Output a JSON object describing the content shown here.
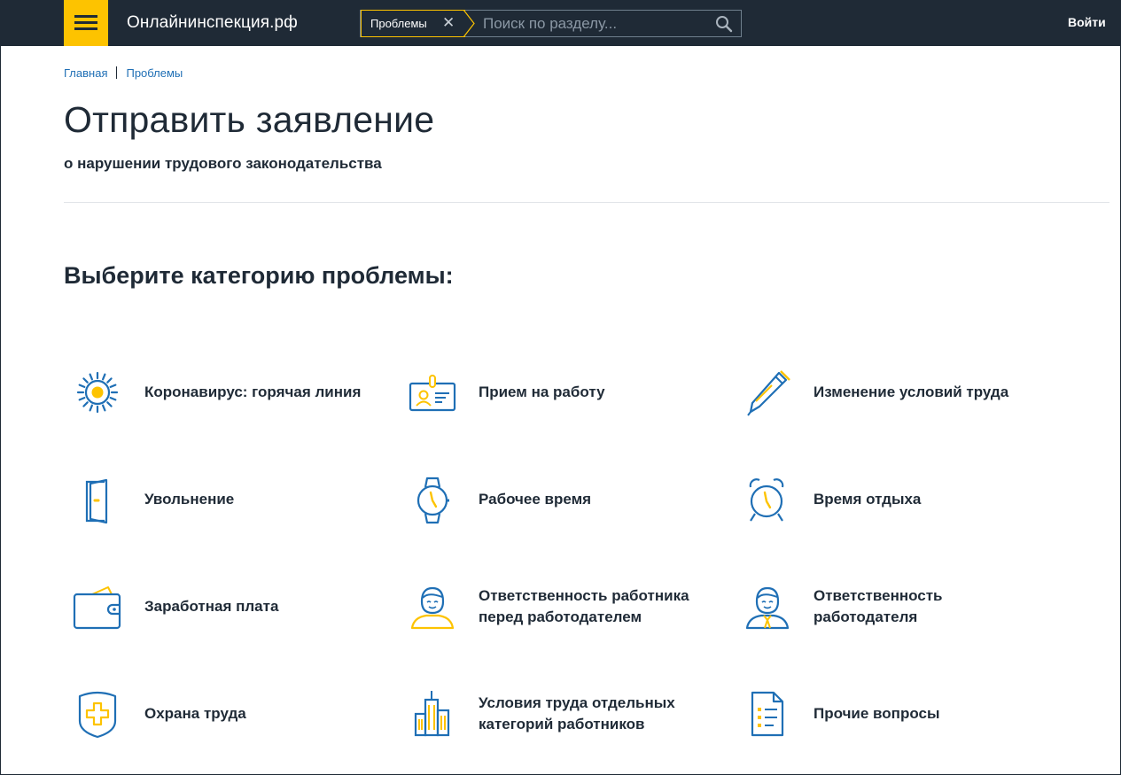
{
  "header": {
    "site_name": "Онлайнинспекция.рф",
    "search_chip": "Проблемы",
    "search_placeholder": "Поиск по разделу...",
    "login_label": "Войти"
  },
  "breadcrumb": [
    "Главная",
    "Проблемы"
  ],
  "page": {
    "title": "Отправить заявление",
    "subtitle": "о нарушении трудового законодательства",
    "section_title": "Выберите категорию проблемы:"
  },
  "categories": [
    {
      "label": "Коронавирус: горячая линия",
      "icon": "virus-icon"
    },
    {
      "label": "Прием на работу",
      "icon": "id-badge-icon"
    },
    {
      "label": "Изменение условий труда",
      "icon": "pen-icon"
    },
    {
      "label": "Увольнение",
      "icon": "door-icon"
    },
    {
      "label": "Рабочее время",
      "icon": "wristwatch-icon"
    },
    {
      "label": "Время отдыха",
      "icon": "alarm-clock-icon"
    },
    {
      "label": "Заработная плата",
      "icon": "wallet-icon"
    },
    {
      "label": "Ответственность работника\nперед работодателем",
      "icon": "employee-icon"
    },
    {
      "label": "Ответственность\nработодателя",
      "icon": "employer-icon"
    },
    {
      "label": "Охрана труда",
      "icon": "shield-cross-icon"
    },
    {
      "label": "Условия труда отдельных\nкатегорий работников",
      "icon": "buildings-icon"
    },
    {
      "label": "Прочие вопросы",
      "icon": "document-list-icon"
    }
  ],
  "colors": {
    "accent": "#fdc300",
    "icon_blue": "#1f6fb5",
    "header_bg": "#1f2a36",
    "link": "#1f6fb5"
  }
}
